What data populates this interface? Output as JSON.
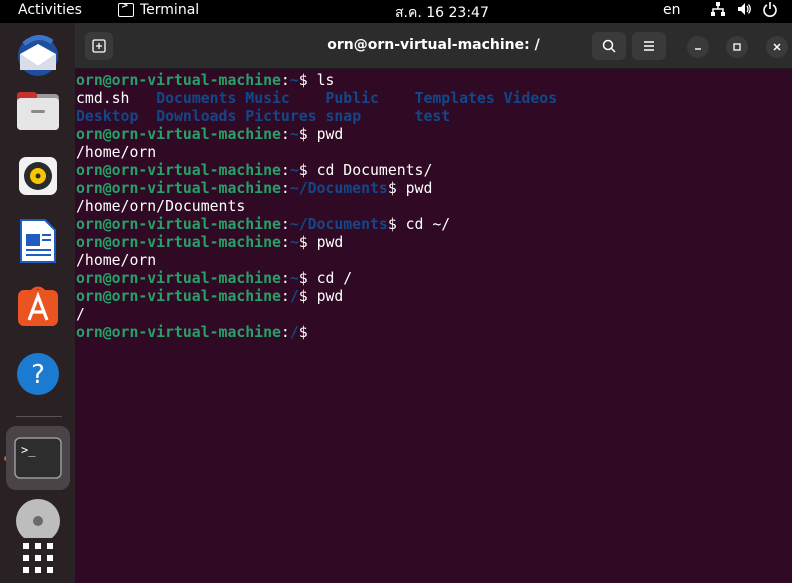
{
  "topbar": {
    "activities": "Activities",
    "app_name": "Terminal",
    "clock": "ส.ค. 16  23:47",
    "lang": "en"
  },
  "dock": {
    "items": [
      "thunderbird",
      "files",
      "rhythmbox",
      "libreoffice-writer",
      "app-center",
      "help",
      "terminal",
      "disc",
      "show-apps"
    ]
  },
  "window": {
    "title": "orn@orn-virtual-machine: /"
  },
  "terminal": {
    "prompt_user": "orn@orn-virtual-machine",
    "lines": [
      {
        "type": "prompt",
        "path": "~",
        "cmd": " ls"
      },
      {
        "type": "ls1",
        "items": [
          "cmd.sh",
          "Documents",
          "Music",
          "Public",
          "Templates",
          "Videos"
        ]
      },
      {
        "type": "ls2",
        "items": [
          "Desktop",
          "Downloads",
          "Pictures",
          "snap",
          "test"
        ]
      },
      {
        "type": "prompt",
        "path": "~",
        "cmd": " pwd"
      },
      {
        "type": "output",
        "text": "/home/orn"
      },
      {
        "type": "prompt",
        "path": "~",
        "cmd": " cd Documents/"
      },
      {
        "type": "prompt",
        "path": "~/Documents",
        "cmd": " pwd"
      },
      {
        "type": "output",
        "text": "/home/orn/Documents"
      },
      {
        "type": "prompt",
        "path": "~/Documents",
        "cmd": " cd ~/"
      },
      {
        "type": "prompt",
        "path": "~",
        "cmd": " pwd"
      },
      {
        "type": "output",
        "text": "/home/orn"
      },
      {
        "type": "prompt",
        "path": "~",
        "cmd": " cd /"
      },
      {
        "type": "prompt",
        "path": "/",
        "cmd": " pwd"
      },
      {
        "type": "output",
        "text": "/"
      },
      {
        "type": "prompt",
        "path": "/",
        "cmd": ""
      }
    ]
  }
}
